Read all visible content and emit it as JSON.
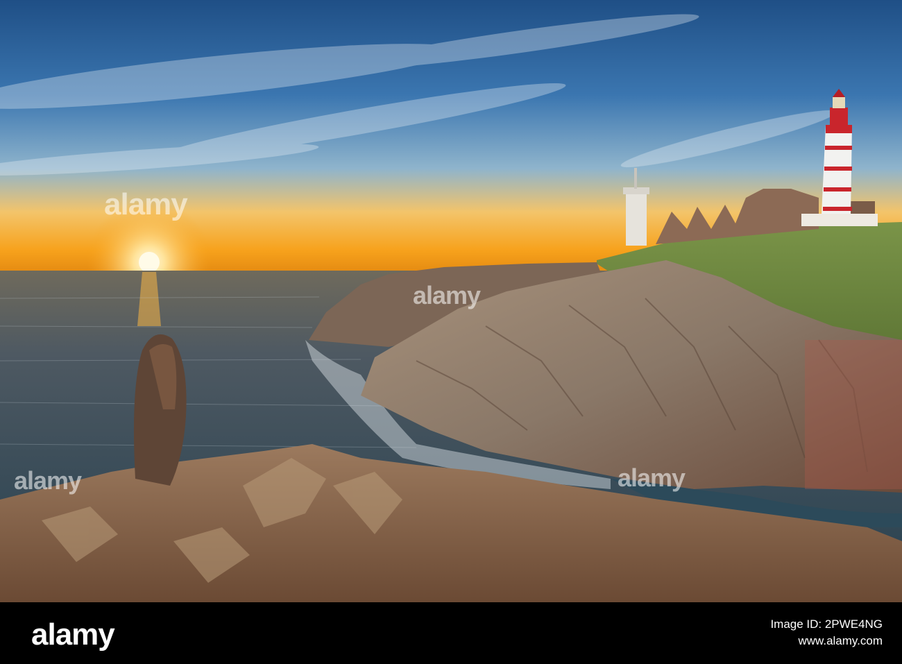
{
  "watermark": {
    "text": "alamy",
    "color": "#ffffff"
  },
  "footer": {
    "logo": "alamy",
    "image_id_label": "Image ID: 2PWE4NG",
    "site": "www.alamy.com",
    "background": "#000000"
  },
  "scene": {
    "sky_top": "#2b5d94",
    "sky_horizon": "#f5a623",
    "sea": "#314a5e",
    "sun": "#fff3c2",
    "lighthouse_red": "#c9252c",
    "lighthouse_white": "#f2f2f0",
    "rock": "#8a7868",
    "grass": "#6d8a3e"
  }
}
